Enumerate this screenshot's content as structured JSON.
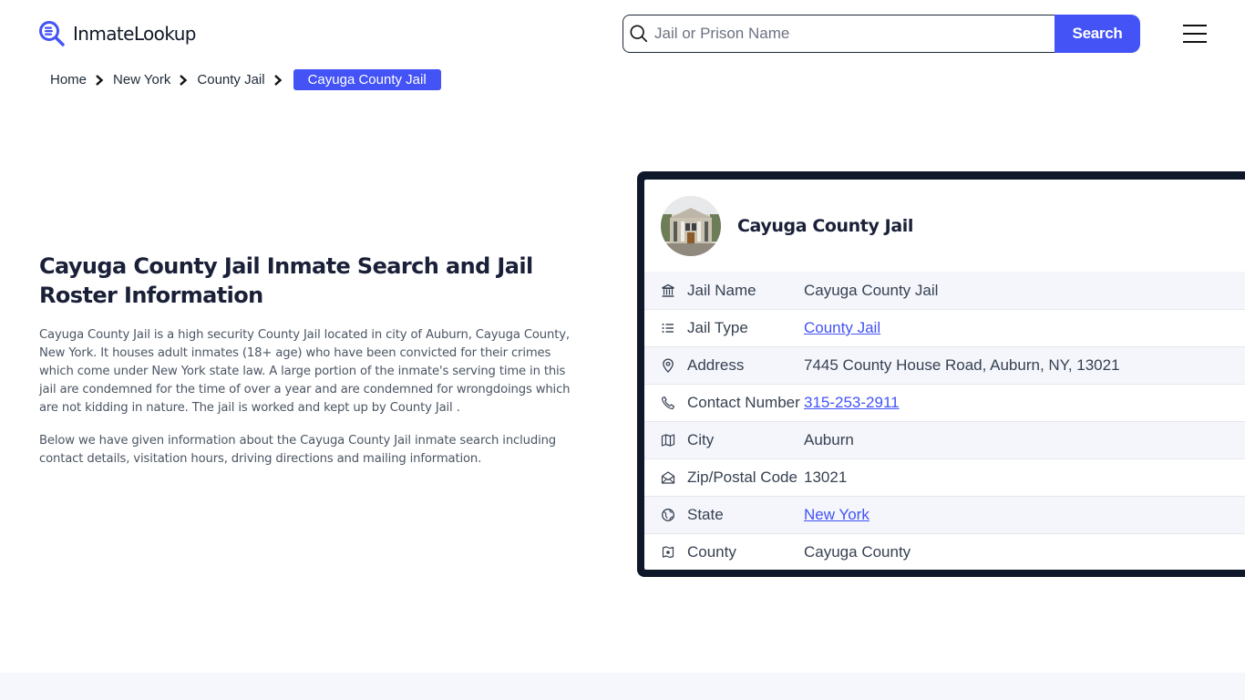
{
  "header": {
    "logo_text": "InmateLookup",
    "search": {
      "placeholder": "Jail or Prison Name",
      "value": "",
      "button_label": "Search"
    },
    "menu_icon": "hamburger-icon"
  },
  "breadcrumb": {
    "items": [
      {
        "label": "Home"
      },
      {
        "label": "New York"
      },
      {
        "label": "County Jail"
      }
    ],
    "current": "Cayuga County Jail"
  },
  "intro": {
    "title": "Cayuga County Jail Inmate Search and Jail Roster Information",
    "paragraphs": [
      "Cayuga County Jail is a high security County Jail located in city of Auburn, Cayuga County, New York. It houses adult inmates (18+ age) who have been convicted for their crimes which come under New York state law. A large portion of the inmate's serving time in this jail are condemned for the time of over a year and are condemned for wrongdoings which are not kidding in nature. The jail is worked and kept up by County Jail .",
      "Below we have given information about the Cayuga County Jail inmate search including contact details, visitation hours, driving directions and mailing information."
    ]
  },
  "card": {
    "title": "Cayuga County Jail",
    "image_alt": "courthouse building photo",
    "rows": [
      {
        "icon": "building-columns-icon",
        "label": "Jail Name",
        "value": "Cayuga County Jail",
        "link": false
      },
      {
        "icon": "list-icon",
        "label": "Jail Type",
        "value": "County Jail",
        "link": true
      },
      {
        "icon": "map-pin-icon",
        "label": "Address",
        "value": "7445 County House Road, Auburn, NY, 13021",
        "link": false
      },
      {
        "icon": "phone-icon",
        "label": "Contact Number",
        "value": "315-253-2911",
        "link": true
      },
      {
        "icon": "map-icon",
        "label": "City",
        "value": "Auburn",
        "link": false
      },
      {
        "icon": "envelope-open-icon",
        "label": "Zip/Postal Code",
        "value": "13021",
        "link": false
      },
      {
        "icon": "globe-icon",
        "label": "State",
        "value": "New York",
        "link": true
      },
      {
        "icon": "county-map-icon",
        "label": "County",
        "value": "Cayuga County",
        "link": false
      }
    ]
  },
  "colors": {
    "brand": "#4353f5",
    "card_border": "#0f172a",
    "heading": "#1a2038",
    "stripe": "#f4f6fc",
    "footer_band": "#f6f6fd"
  }
}
